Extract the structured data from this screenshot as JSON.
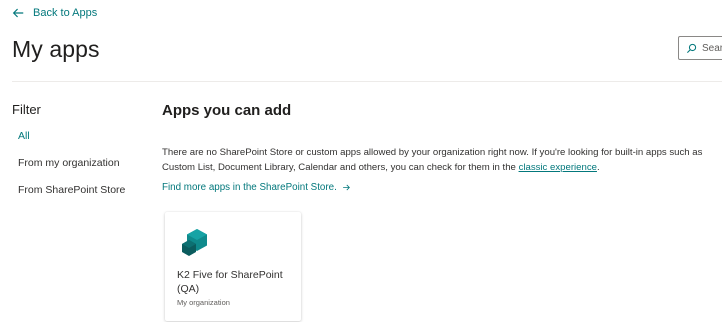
{
  "header": {
    "back_label": "Back to Apps",
    "page_title": "My apps",
    "search_placeholder": "Search"
  },
  "filter": {
    "title": "Filter",
    "items": [
      {
        "label": "All",
        "active": true
      },
      {
        "label": "From my organization",
        "active": false
      },
      {
        "label": "From SharePoint Store",
        "active": false
      }
    ]
  },
  "main": {
    "section_title": "Apps you can add",
    "notice_text": "There are no SharePoint Store or custom apps allowed by your organization right now. If you're looking for built-in apps such as Custom List, Document Library, Calendar and others, you can check for them in the ",
    "notice_link": "classic experience",
    "notice_end": ".",
    "store_link": "Find more apps in the SharePoint Store."
  },
  "apps": [
    {
      "name": "K2 Five for SharePoint (QA)",
      "source": "My organization",
      "icon": "k2-hexagon-logo"
    }
  ],
  "colors": {
    "accent": "#03787c",
    "logo_dark": "#0b5c5e",
    "logo_light": "#0f8a8c"
  }
}
